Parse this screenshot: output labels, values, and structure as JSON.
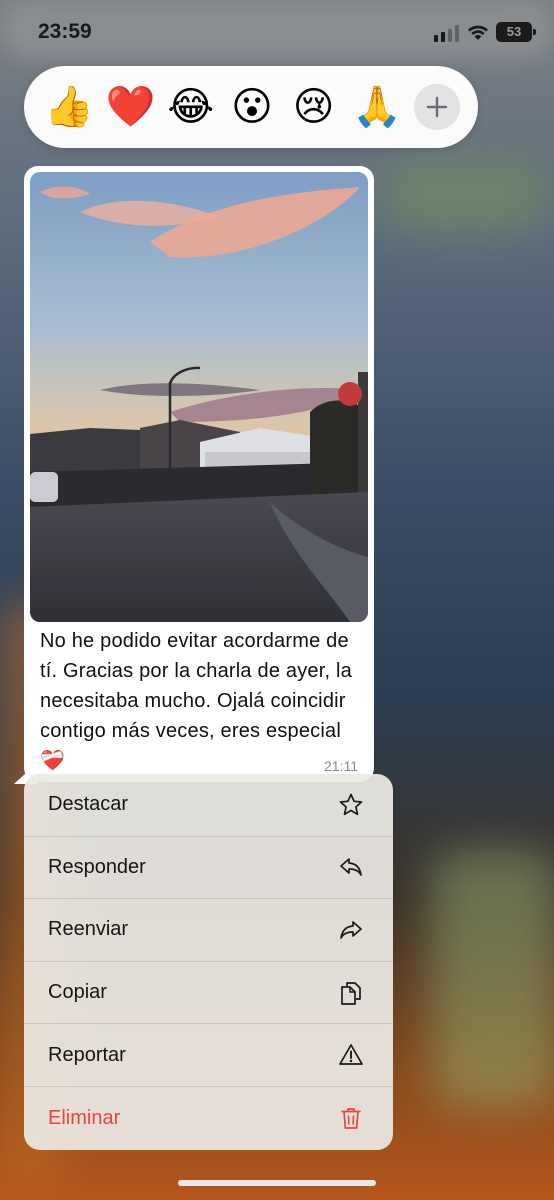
{
  "status_bar": {
    "time": "23:59",
    "battery": "53"
  },
  "reactions": {
    "items": [
      {
        "emoji": "👍",
        "name": "thumbs-up"
      },
      {
        "emoji": "❤️",
        "name": "red-heart"
      },
      {
        "emoji": "😂",
        "name": "tears-of-joy"
      },
      {
        "emoji": "😮",
        "name": "surprised"
      },
      {
        "emoji": "😢",
        "name": "crying"
      },
      {
        "emoji": "🙏",
        "name": "folded-hands"
      }
    ],
    "more_icon": "plus-icon"
  },
  "message": {
    "text": "No he podido evitar acordarme de tí. Gracias por la charla de ayer, la necesitaba mucho. Ojalá coincidir contigo más veces, eres especial ❤️‍🩹",
    "time": "21:11"
  },
  "menu": {
    "items": [
      {
        "label": "Destacar",
        "icon": "star-icon"
      },
      {
        "label": "Responder",
        "icon": "reply-icon"
      },
      {
        "label": "Reenviar",
        "icon": "forward-icon"
      },
      {
        "label": "Copiar",
        "icon": "copy-icon"
      },
      {
        "label": "Reportar",
        "icon": "warning-icon"
      },
      {
        "label": "Eliminar",
        "icon": "trash-icon"
      }
    ]
  },
  "colors": {
    "destructive": "#e5473f",
    "bubble": "#ffffff",
    "menu_bg": "#ece9e4"
  }
}
